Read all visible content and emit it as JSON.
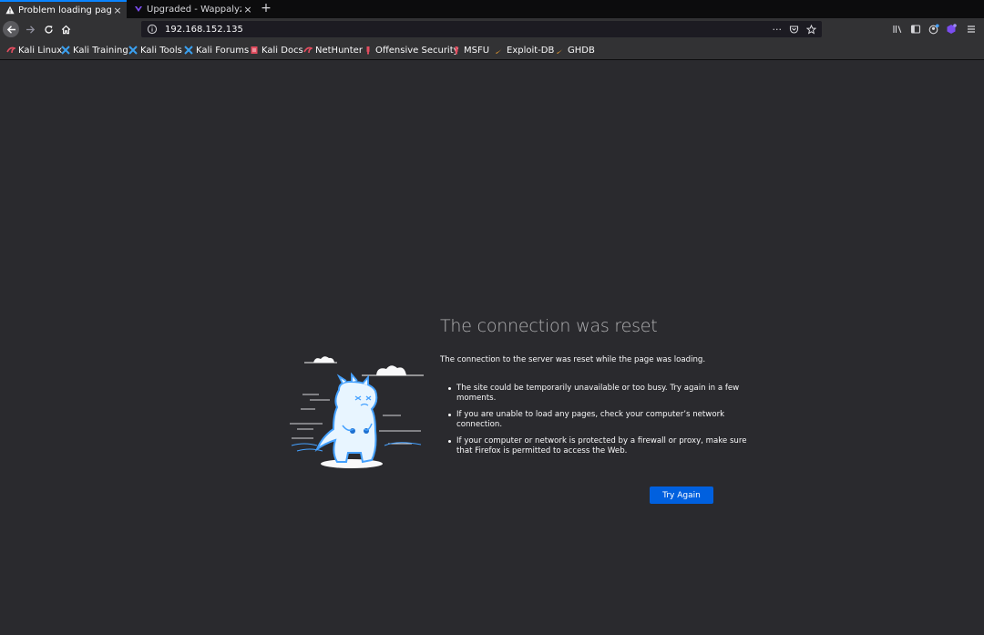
{
  "tabs": [
    {
      "title": "Problem loading page",
      "icon": "warning-icon",
      "active": true,
      "close": "×"
    },
    {
      "title": "Upgraded - Wappalyzer",
      "icon": "wappalyzer-icon",
      "active": false,
      "close": "×"
    }
  ],
  "new_tab": "+",
  "nav": {
    "back_icon": "arrow-left-icon",
    "forward_icon": "arrow-right-icon",
    "reload_icon": "reload-icon",
    "home_icon": "home-icon",
    "url": "192.168.152.135",
    "page_actions": "···",
    "pocket_icon": "pocket-icon",
    "bookmark_star_icon": "star-icon"
  },
  "toolbar_icons": [
    "library-icon",
    "sidebar-icon",
    "account-icon",
    "extension-icon",
    "menu-icon"
  ],
  "bookmarks": [
    {
      "label": "Kali Linux",
      "icon": "kali-icon"
    },
    {
      "label": "Kali Training",
      "icon": "kali-tools-icon"
    },
    {
      "label": "Kali Tools",
      "icon": "kali-tools-icon"
    },
    {
      "label": "Kali Forums",
      "icon": "kali-tools-icon"
    },
    {
      "label": "Kali Docs",
      "icon": "docs-icon"
    },
    {
      "label": "NetHunter",
      "icon": "kali-icon"
    },
    {
      "label": "Offensive Security",
      "icon": "offsec-icon"
    },
    {
      "label": "MSFU",
      "icon": "offsec-icon"
    },
    {
      "label": "Exploit-DB",
      "icon": "exploitdb-icon"
    },
    {
      "label": "GHDB",
      "icon": "exploitdb-icon"
    }
  ],
  "error": {
    "title": "The connection was reset",
    "description": "The connection to the server was reset while the page was loading.",
    "bullets": [
      "The site could be temporarily unavailable or too busy. Try again in a few moments.",
      "If you are unable to load any pages, check your computer’s network connection.",
      "If your computer or network is protected by a firewall or proxy, make sure that Firefox is permitted to access the Web."
    ],
    "button": "Try Again"
  },
  "colors": {
    "page_bg": "#2a2a2e",
    "chrome_bg": "#323234",
    "tabstrip_bg": "#0c0c0d",
    "accent": "#0060df"
  }
}
